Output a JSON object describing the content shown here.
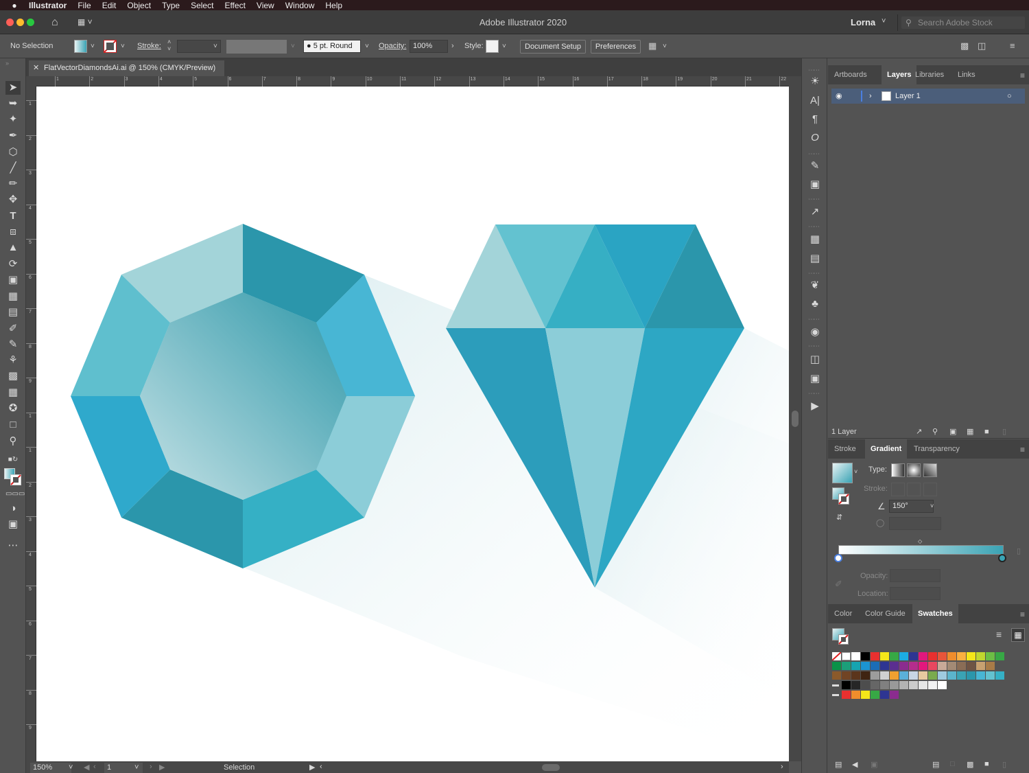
{
  "menubar": {
    "apple": "",
    "app": "Illustrator",
    "items": [
      "File",
      "Edit",
      "Object",
      "Type",
      "Select",
      "Effect",
      "View",
      "Window",
      "Help"
    ]
  },
  "titlebar": {
    "title": "Adobe Illustrator 2020",
    "user": "Lorna",
    "search_placeholder": "Search Adobe Stock"
  },
  "controlbar": {
    "selection": "No Selection",
    "stroke_label": "Stroke:",
    "brush": "5 pt. Round",
    "opacity_label": "Opacity:",
    "opacity_value": "100%",
    "style_label": "Style:",
    "document_setup": "Document Setup",
    "preferences": "Preferences"
  },
  "document": {
    "tab_title": "FlatVectorDiamondsAi.ai @ 150% (CMYK/Preview)"
  },
  "ruler": {
    "h_ticks": [
      "1",
      "2",
      "3",
      "4",
      "5",
      "6",
      "7",
      "8",
      "9",
      "10",
      "11",
      "12",
      "13",
      "14",
      "15",
      "16",
      "17",
      "18",
      "19",
      "20",
      "21",
      "22"
    ],
    "v_ticks": [
      "1",
      "2",
      "3",
      "4",
      "5",
      "6",
      "7",
      "8",
      "9",
      "1",
      "1",
      "2",
      "3",
      "4",
      "5",
      "6",
      "7",
      "8",
      "9"
    ]
  },
  "status": {
    "zoom": "150%",
    "page": "1",
    "mode": "Selection"
  },
  "layers_panel": {
    "tabs": [
      "Artboards",
      "Layers",
      "Libraries",
      "Links"
    ],
    "active_tab": "Layers",
    "layer_name": "Layer 1",
    "count": "1 Layer"
  },
  "gradient_panel": {
    "tabs": [
      "Stroke",
      "Gradient",
      "Transparency"
    ],
    "active_tab": "Gradient",
    "type_label": "Type:",
    "stroke_label": "Stroke:",
    "angle": "150°",
    "opacity_label": "Opacity:",
    "location_label": "Location:"
  },
  "swatches_panel": {
    "tabs": [
      "Color",
      "Color Guide",
      "Swatches"
    ],
    "active_tab": "Swatches"
  },
  "colors": {
    "gem_light": "#a3d4d9",
    "gem_mid": "#5fbfce",
    "gem_blue": "#48b6d4",
    "gem_dark": "#2b96ab",
    "gem_deep": "#2c9dbb",
    "gem_pale": "#8ccdd8",
    "accent_layer": "#4b5e7a"
  }
}
